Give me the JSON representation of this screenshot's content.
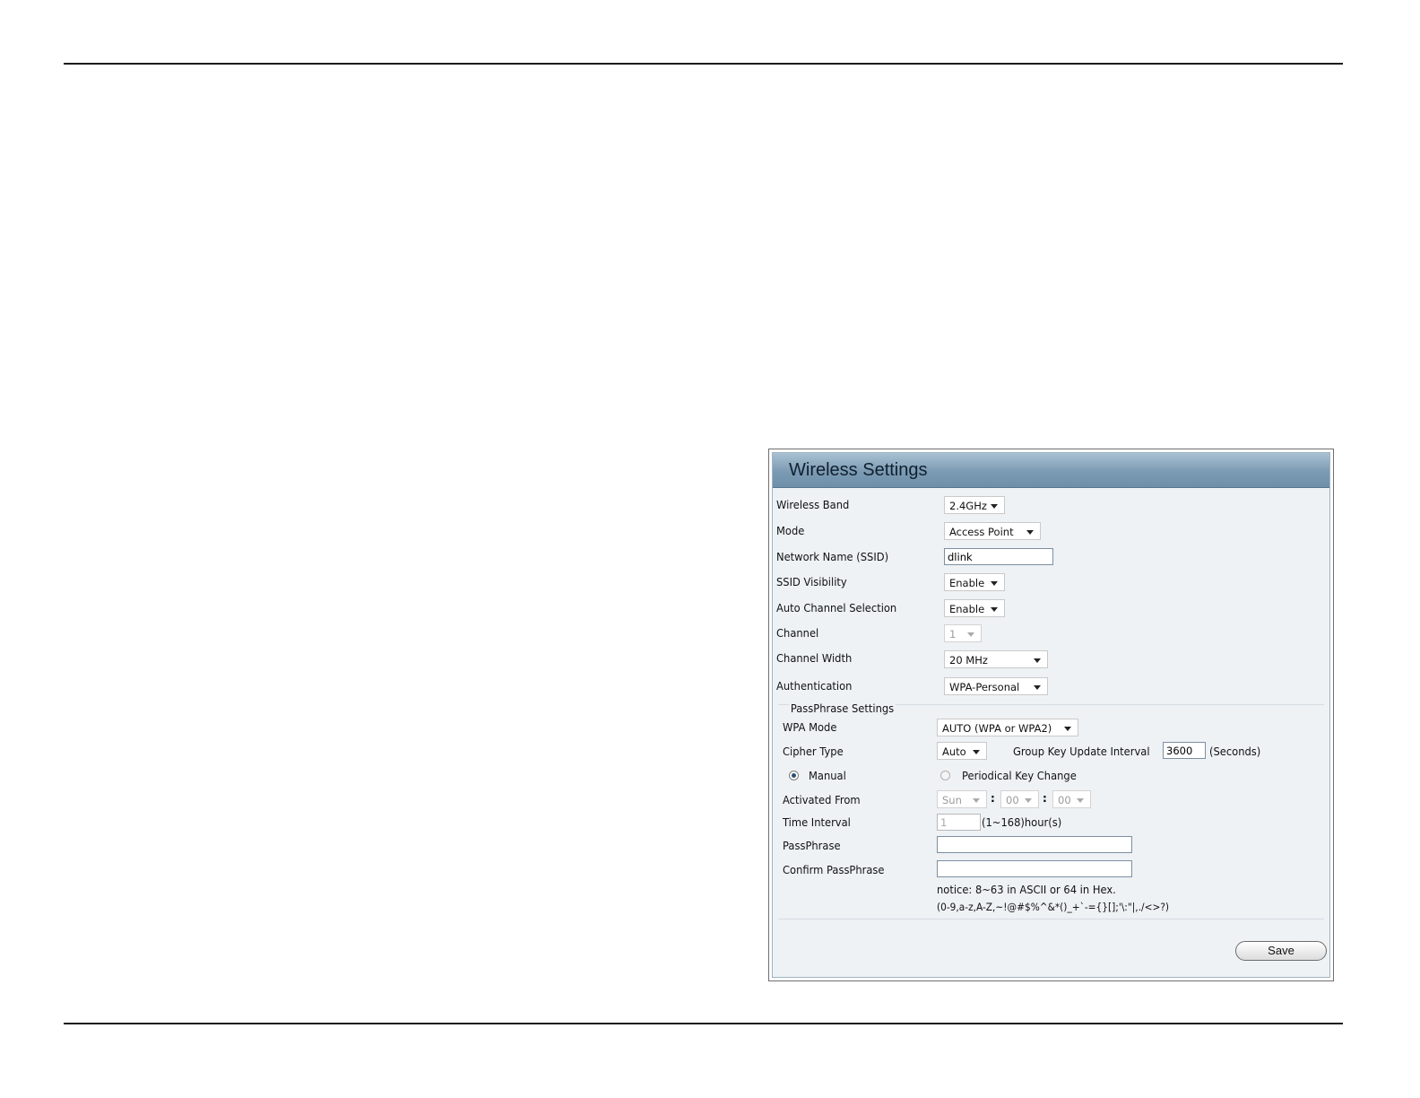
{
  "panel": {
    "title": "Wireless Settings",
    "fields": {
      "wireless_band": {
        "label": "Wireless Band",
        "value": "2.4GHz"
      },
      "mode": {
        "label": "Mode",
        "value": "Access Point"
      },
      "ssid": {
        "label": "Network Name (SSID)",
        "value": "dlink"
      },
      "ssid_visibility": {
        "label": "SSID Visibility",
        "value": "Enable"
      },
      "auto_channel": {
        "label": "Auto Channel Selection",
        "value": "Enable"
      },
      "channel": {
        "label": "Channel",
        "value": "1"
      },
      "channel_width": {
        "label": "Channel Width",
        "value": "20 MHz"
      },
      "authentication": {
        "label": "Authentication",
        "value": "WPA-Personal"
      }
    },
    "passphrase_settings": {
      "legend": "PassPhrase Settings",
      "wpa_mode": {
        "label": "WPA Mode",
        "value": "AUTO (WPA or WPA2)"
      },
      "cipher_type": {
        "label": "Cipher Type",
        "value": "Auto"
      },
      "group_key": {
        "label": "Group Key Update Interval",
        "value": "3600",
        "unit": "(Seconds)"
      },
      "manual_radio": {
        "label": "Manual",
        "selected": true
      },
      "periodical_radio": {
        "label": "Periodical Key Change",
        "selected": false
      },
      "activated_from": {
        "label": "Activated From",
        "day": "Sun",
        "hour": "00",
        "minute": "00",
        "sep": ":"
      },
      "time_interval": {
        "label": "Time Interval",
        "value": "1",
        "unit": "(1~168)hour(s)"
      },
      "passphrase": {
        "label": "PassPhrase",
        "value": ""
      },
      "confirm_passphrase": {
        "label": "Confirm PassPhrase",
        "value": ""
      },
      "notice_line1": "notice: 8~63 in ASCII or 64 in Hex.",
      "notice_line2": "(0-9,a-z,A-Z,~!@#$%^&*()_+`-={}[];'\\:\"|,./<>?)"
    },
    "save_label": "Save"
  }
}
